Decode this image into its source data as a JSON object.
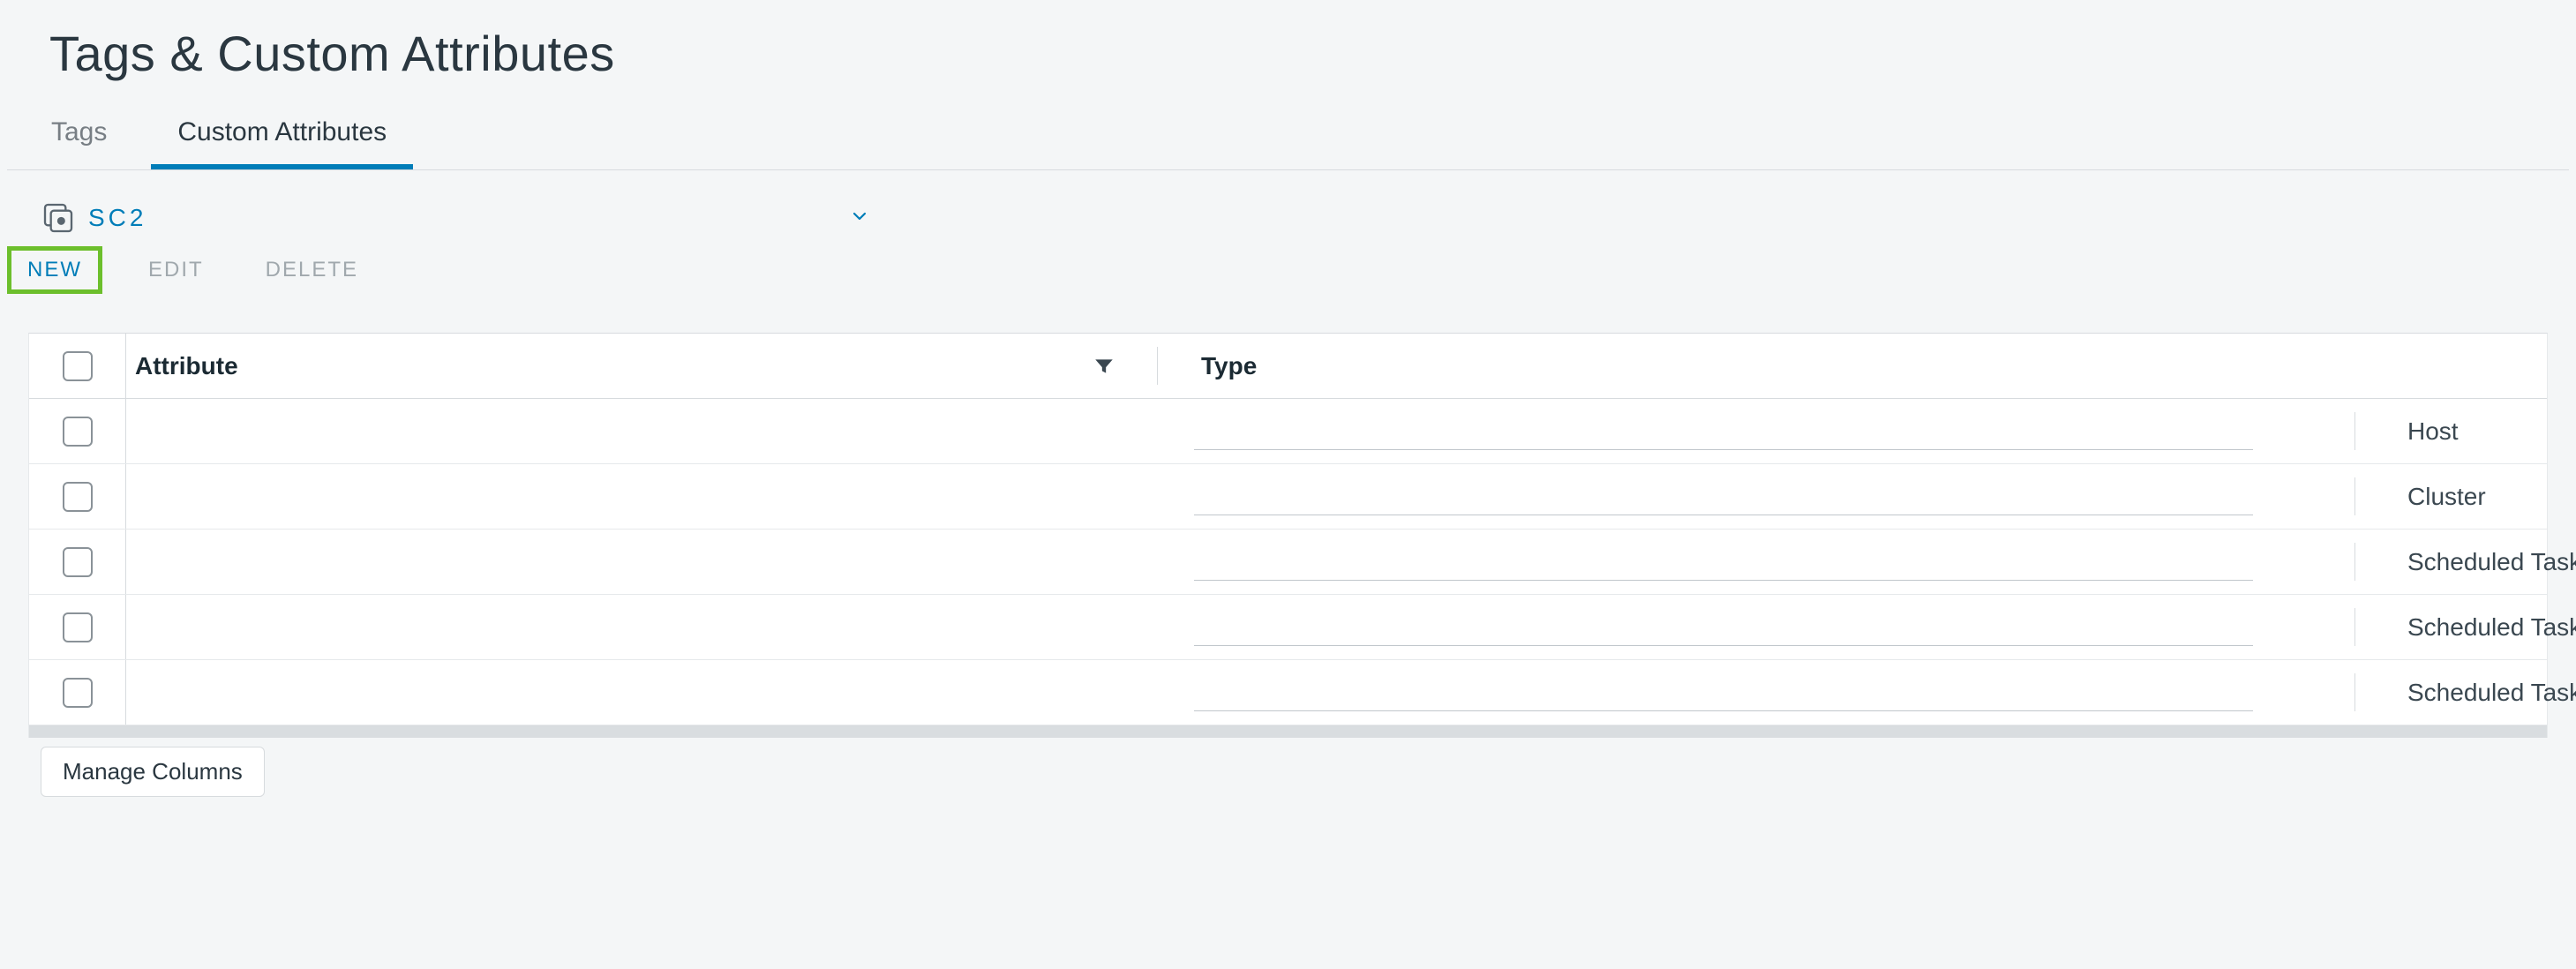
{
  "title": "Tags & Custom Attributes",
  "tabs": [
    {
      "label": "Tags",
      "active": false
    },
    {
      "label": "Custom Attributes",
      "active": true
    }
  ],
  "context": {
    "label": "SC2"
  },
  "actions": {
    "new": "NEW",
    "edit": "EDIT",
    "delete": "DELETE"
  },
  "table": {
    "headers": {
      "attribute": "Attribute",
      "type": "Type"
    },
    "rows": [
      {
        "attribute": "",
        "type": "Host"
      },
      {
        "attribute": "",
        "type": "Cluster"
      },
      {
        "attribute": "",
        "type": "Scheduled Task"
      },
      {
        "attribute": "",
        "type": "Scheduled Task"
      },
      {
        "attribute": "",
        "type": "Scheduled Task"
      }
    ],
    "manage_columns": "Manage Columns"
  }
}
